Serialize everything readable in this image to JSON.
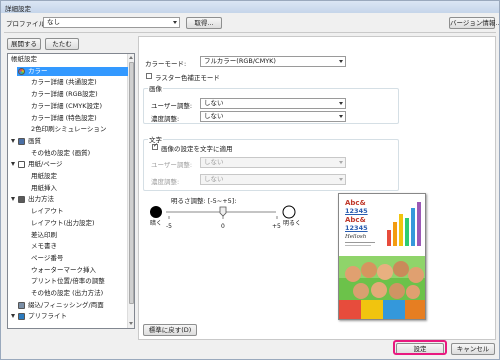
{
  "window": {
    "title": "詳細設定"
  },
  "toolbar": {
    "profile_label": "プロファイル:",
    "profile_value": "なし",
    "import_label": "取得...",
    "version_label": "バージョン情報..."
  },
  "tree": {
    "expand_label": "展開する",
    "collapse_label": "たたむ",
    "items": [
      {
        "label": "帳紙設定",
        "indent": 0,
        "expander": false,
        "icon": "",
        "selected": false
      },
      {
        "label": "カラー",
        "indent": 1,
        "expander": true,
        "icon": "color-icon",
        "selected": true
      },
      {
        "label": "カラー詳細 (共通設定)",
        "indent": 2,
        "expander": false,
        "icon": "",
        "selected": false
      },
      {
        "label": "カラー詳細 (RGB設定)",
        "indent": 2,
        "expander": false,
        "icon": "",
        "selected": false
      },
      {
        "label": "カラー詳細 (CMYK設定)",
        "indent": 2,
        "expander": false,
        "icon": "",
        "selected": false
      },
      {
        "label": "カラー詳細 (特色設定)",
        "indent": 2,
        "expander": false,
        "icon": "",
        "selected": false
      },
      {
        "label": "2色印刷シミュレーション",
        "indent": 2,
        "expander": false,
        "icon": "",
        "selected": false
      },
      {
        "label": "画質",
        "indent": 1,
        "expander": true,
        "icon": "image-quality-icon",
        "selected": false
      },
      {
        "label": "その他の設定 (画質)",
        "indent": 2,
        "expander": false,
        "icon": "",
        "selected": false
      },
      {
        "label": "用紙/ページ",
        "indent": 1,
        "expander": true,
        "icon": "paper-icon",
        "selected": false
      },
      {
        "label": "用紙設定",
        "indent": 2,
        "expander": false,
        "icon": "",
        "selected": false
      },
      {
        "label": "用紙挿入",
        "indent": 2,
        "expander": false,
        "icon": "",
        "selected": false
      },
      {
        "label": "出力方法",
        "indent": 1,
        "expander": true,
        "icon": "output-icon",
        "selected": false
      },
      {
        "label": "レイアウト",
        "indent": 2,
        "expander": false,
        "icon": "",
        "selected": false
      },
      {
        "label": "レイアウト(出力設定)",
        "indent": 2,
        "expander": false,
        "icon": "",
        "selected": false
      },
      {
        "label": "差込印刷",
        "indent": 2,
        "expander": false,
        "icon": "",
        "selected": false
      },
      {
        "label": "メモ書き",
        "indent": 2,
        "expander": false,
        "icon": "",
        "selected": false
      },
      {
        "label": "ページ番号",
        "indent": 2,
        "expander": false,
        "icon": "",
        "selected": false
      },
      {
        "label": "ウォーターマーク挿入",
        "indent": 2,
        "expander": false,
        "icon": "",
        "selected": false
      },
      {
        "label": "プリント位置/倍率の調整",
        "indent": 2,
        "expander": false,
        "icon": "",
        "selected": false
      },
      {
        "label": "その他の設定 (出力方法)",
        "indent": 2,
        "expander": false,
        "icon": "",
        "selected": false
      },
      {
        "label": "綴込/フィニッシング/両面",
        "indent": 1,
        "expander": false,
        "icon": "finishing-icon",
        "selected": false
      },
      {
        "label": "プリフライト",
        "indent": 1,
        "expander": true,
        "icon": "preflight-icon",
        "selected": false
      }
    ]
  },
  "color": {
    "mode_label": "カラーモード:",
    "mode_value": "フルカラー(RGB/CMYK)",
    "raster_label": "ラスター色補正モード",
    "raster_checked": false,
    "image_group": "画像",
    "user_adjust_label": "ユーザー調整:",
    "user_adjust_value": "しない",
    "density_label": "濃度調整:",
    "density_value": "しない",
    "text_group": "文字",
    "apply_image_label": "画像の設定を文字に適用",
    "apply_image_checked": true,
    "text_user_adjust_label": "ユーザー調整:",
    "text_user_adjust_value": "しない",
    "text_density_label": "濃度調整:",
    "text_density_value": "しない",
    "brightness_label": "明るさ調整: [-5~+5]:",
    "brightness_value": 0,
    "brightness_min": "-5",
    "brightness_max": "+5",
    "brightness_zero": "0",
    "dark_label": "暗く",
    "light_label": "明るく",
    "reset_label": "標準に戻す(D)"
  },
  "preview": {
    "line1": "Abc&",
    "line2": "12345",
    "line3": "Abc&",
    "line4": "12345",
    "line5": "Hellosh"
  },
  "footer": {
    "ok_label": "設定",
    "cancel_label": "キャンセル"
  },
  "colors": {
    "highlight": "#e8197f",
    "selection": "#3399ff"
  }
}
